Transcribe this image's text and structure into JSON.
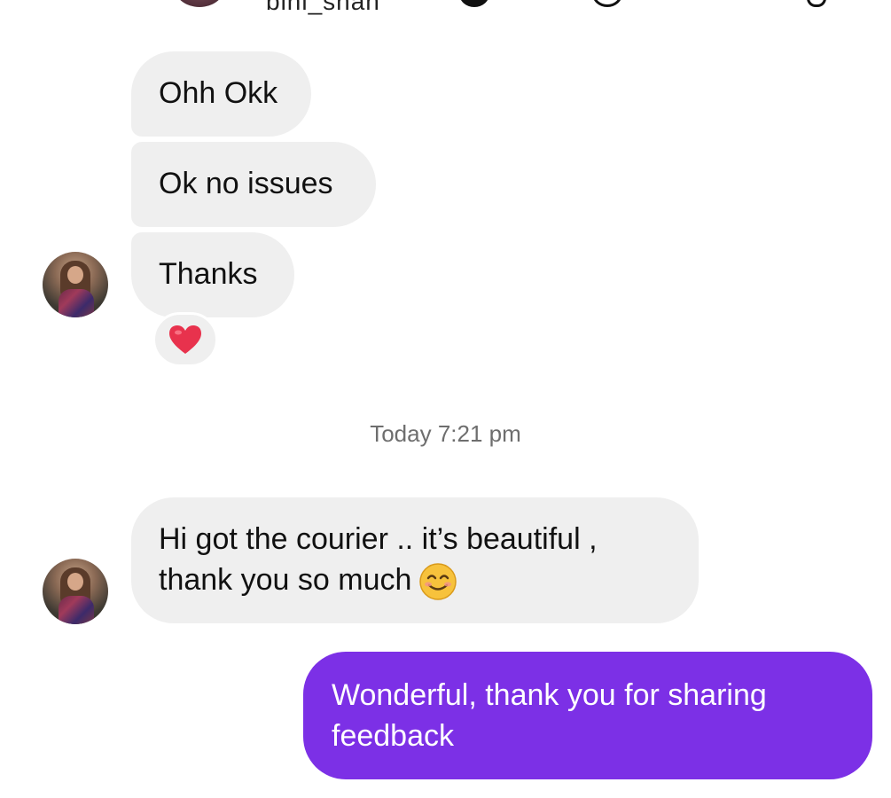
{
  "header": {
    "username": "bini_shah"
  },
  "messages": [
    {
      "sender": "them",
      "text": "Ohh Okk"
    },
    {
      "sender": "them",
      "text": "Ok no issues"
    },
    {
      "sender": "them",
      "text": "Thanks",
      "reaction": "heart-emoji"
    },
    {
      "sender": "them",
      "lines": [
        "Hi got the courier .. it’s beautiful ,",
        "thank you so much"
      ],
      "trailing_emoji": "smiling-face-emoji"
    },
    {
      "sender": "me",
      "lines": [
        "Wonderful,  thank you for sharing",
        "feedback"
      ]
    }
  ],
  "timestamp": "Today 7:21 pm",
  "colors": {
    "incoming_bubble": "#efefef",
    "outgoing_bubble": "#7c30e6",
    "outgoing_text": "#ffffff",
    "timestamp_text": "#6e6e6e",
    "heart": "#e8324d"
  }
}
